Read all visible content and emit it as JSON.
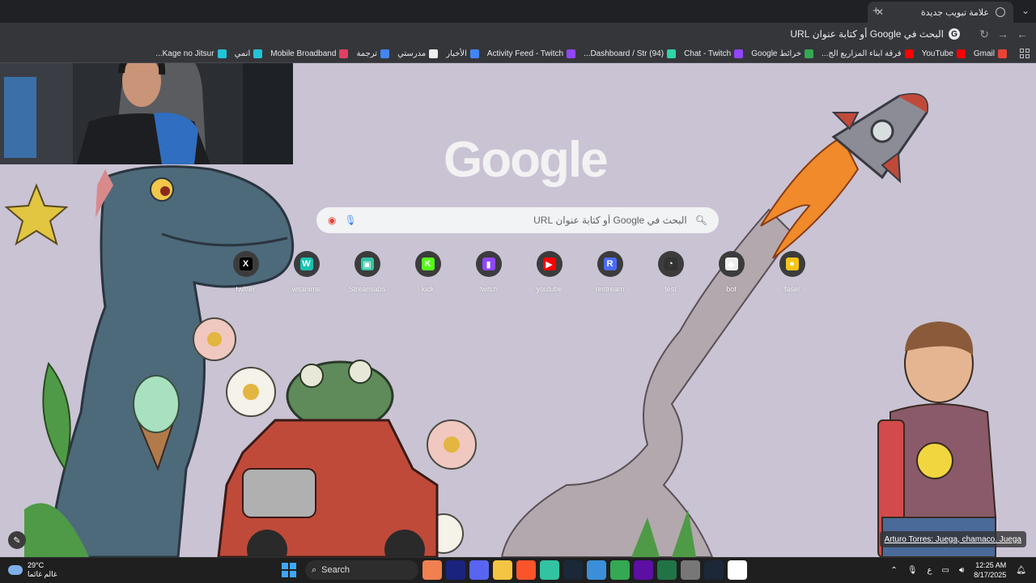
{
  "browser": {
    "tab_title": "علامة تبويب جديدة",
    "omnibox_text": "البحث في Google أو كتابة عنوان URL",
    "bookmarks": [
      {
        "label": "Gmail",
        "color": "#ea4335"
      },
      {
        "label": "YouTube",
        "color": "#ff0000"
      },
      {
        "label": "فرقة ابناء المزاريع الج...",
        "color": "#ff0000"
      },
      {
        "label": "خرائط Google",
        "color": "#34a853"
      },
      {
        "label": "Chat - Twitch",
        "color": "#9146ff"
      },
      {
        "label": "(94) Dashboard / Str...",
        "color": "#2ed3a6"
      },
      {
        "label": "Activity Feed - Twitch",
        "color": "#9146ff"
      },
      {
        "label": "الأخبار",
        "color": "#4285f4"
      },
      {
        "label": "مدرستي",
        "color": "#eeeeee"
      },
      {
        "label": "ترجمة",
        "color": "#4285f4"
      },
      {
        "label": "Mobile Broadband",
        "color": "#e04060"
      },
      {
        "label": "انمي",
        "color": "#22c3d6"
      },
      {
        "label": "Kage no Jitsur...",
        "color": "#22c3d6"
      }
    ]
  },
  "google": {
    "logo": "Google",
    "search_placeholder": "البحث في Google أو كتابة عنوان URL"
  },
  "shortcuts": [
    {
      "label": "twitter",
      "glyph": "X",
      "color": "#000000"
    },
    {
      "label": "witanime",
      "glyph": "W",
      "color": "#18c2b0"
    },
    {
      "label": "Streamlabs",
      "glyph": "▣",
      "color": "#31c3a2"
    },
    {
      "label": "kick",
      "glyph": "K",
      "color": "#53fc18"
    },
    {
      "label": "twitch",
      "glyph": "▮",
      "color": "#9146ff"
    },
    {
      "label": "youtube",
      "glyph": "▶",
      "color": "#ff0000"
    },
    {
      "label": "restream",
      "glyph": "R",
      "color": "#4b6bfb"
    },
    {
      "label": "test",
      "glyph": "◔",
      "color": "#333333"
    },
    {
      "label": "bot",
      "glyph": "◆",
      "color": "#eeeeee"
    },
    {
      "label": "fasel",
      "glyph": "●",
      "color": "#f5c518"
    }
  ],
  "background_credit": "Arturo Torres: Juega, chamaco. Juega",
  "taskbar": {
    "temperature": "29°C",
    "weather_desc": "غالم غائما",
    "search_label": "Search",
    "apps": [
      {
        "name": "wpmanager",
        "color": "#f08050"
      },
      {
        "name": "netflix",
        "color": "#1a237e"
      },
      {
        "name": "discord",
        "color": "#5865f2"
      },
      {
        "name": "explorer",
        "color": "#f4c542"
      },
      {
        "name": "brave",
        "color": "#fb542b"
      },
      {
        "name": "streamlabs",
        "color": "#31c3a2"
      },
      {
        "name": "steam",
        "color": "#1b2838"
      },
      {
        "name": "app",
        "color": "#3a8fd8"
      },
      {
        "name": "chrome",
        "color": "#34a853"
      },
      {
        "name": "next",
        "color": "#5c0fa3"
      },
      {
        "name": "excel",
        "color": "#217346"
      },
      {
        "name": "app2",
        "color": "#777777"
      },
      {
        "name": "steam2",
        "color": "#1b2838"
      },
      {
        "name": "capcut",
        "color": "#ffffff"
      }
    ],
    "language": "ع",
    "time": "12:25 AM",
    "date": "8/17/2025"
  }
}
